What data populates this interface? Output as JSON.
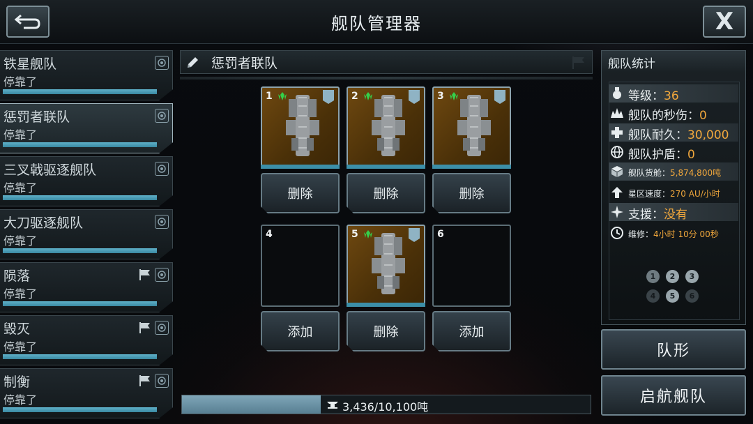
{
  "header": {
    "title": "舰队管理器",
    "back_icon": "back-arrow-icon",
    "close_label": "X"
  },
  "sidebar": {
    "items": [
      {
        "name": "铁星舰队",
        "status": "停靠了",
        "active": false,
        "flag": false
      },
      {
        "name": "惩罚者联队",
        "status": "停靠了",
        "active": true,
        "flag": false
      },
      {
        "name": "三叉戟驱逐舰队",
        "status": "停靠了",
        "active": false,
        "flag": false
      },
      {
        "name": "大刀驱逐舰队",
        "status": "停靠了",
        "active": false,
        "flag": false
      },
      {
        "name": "陨落",
        "status": "停靠了",
        "active": false,
        "flag": true
      },
      {
        "name": "毁灭",
        "status": "停靠了",
        "active": false,
        "flag": true
      },
      {
        "name": "制衡",
        "status": "停靠了",
        "active": false,
        "flag": true
      }
    ]
  },
  "fleet": {
    "name": "惩罚者联队",
    "slots": [
      {
        "num": "1",
        "filled": true,
        "action": "删除"
      },
      {
        "num": "2",
        "filled": true,
        "action": "删除"
      },
      {
        "num": "3",
        "filled": true,
        "action": "删除"
      },
      {
        "num": "4",
        "filled": false,
        "action": "添加"
      },
      {
        "num": "5",
        "filled": true,
        "action": "删除"
      },
      {
        "num": "6",
        "filled": false,
        "action": "添加"
      }
    ],
    "cargo": {
      "text": "3,436/10,100吨",
      "used": 3436,
      "capacity": 10100
    }
  },
  "stats": {
    "title": "舰队统计",
    "level_label": "等级：",
    "level": "36",
    "dps_label": "舰队的秒伤：",
    "dps": "0",
    "hull_label": "舰队耐久：",
    "hull": "30,000",
    "shield_label": "舰队护盾：",
    "shield": "0",
    "cargo_label": "舰队货舱：",
    "cargo": "5,874,800吨",
    "speed_label": "星区速度：",
    "speed": "270 AU/小时",
    "support_label": "支援：",
    "support": "没有",
    "repair_label": "维修：",
    "repair": "4小时 10分 00秒",
    "formation_dots": [
      "1",
      "2",
      "3",
      "4",
      "5",
      "6"
    ]
  },
  "buttons": {
    "formation": "队形",
    "launch": "启航舰队"
  },
  "colors": {
    "accent_value": "#f0a73c",
    "bar": "#3c8fa8",
    "slot_fill": "#6e4810",
    "rank_green": "#34d04a"
  }
}
